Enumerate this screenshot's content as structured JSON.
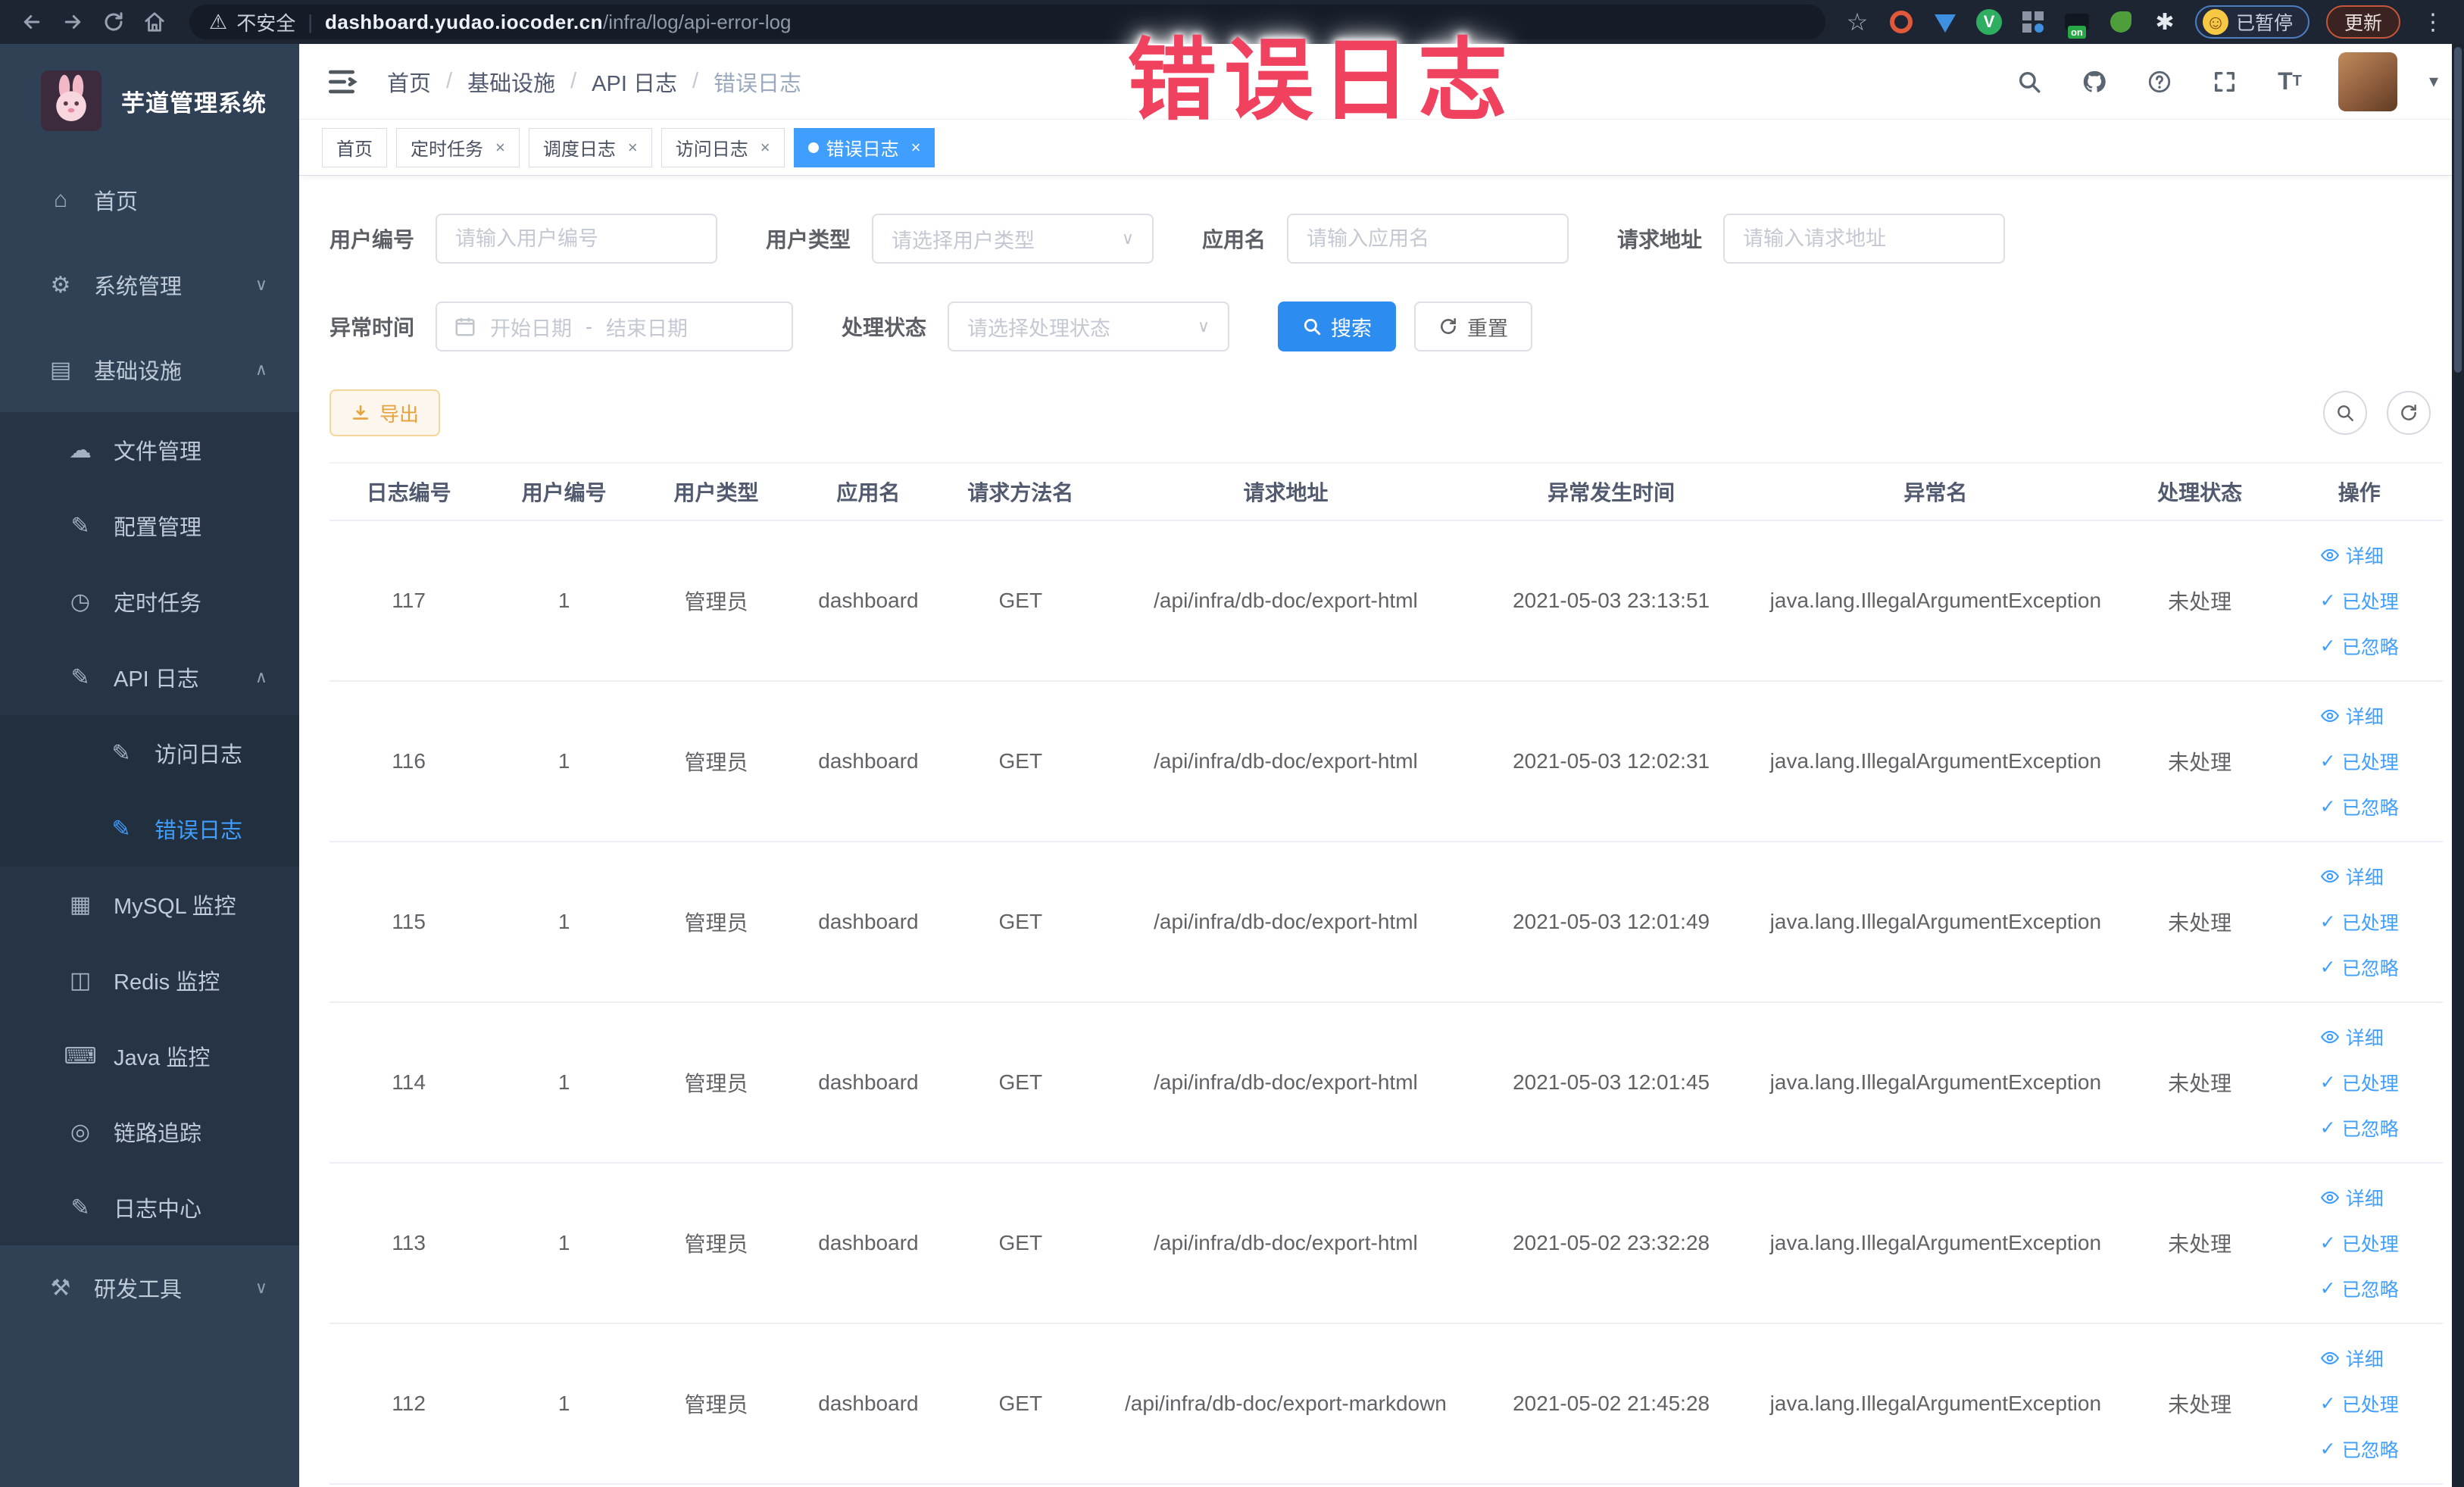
{
  "browser": {
    "security_label": "不安全",
    "url_domain": "dashboard.yudao.iocoder.cn",
    "url_path": "/infra/log/api-error-log",
    "paused_label": "已暂停",
    "update_label": "更新",
    "extension_icons": [
      "star-icon",
      "orange-circle-extension-icon",
      "shield-extension-icon",
      "green-v-extension-icon",
      "grid-extension-icon",
      "onoff-extension-icon",
      "leaf-extension-icon",
      "puzzle-extension-icon"
    ]
  },
  "overlay": {
    "text": "错误日志",
    "color": "#f0415f"
  },
  "sidebar": {
    "title": "芋道管理系统",
    "items": [
      {
        "label": "首页",
        "icon": "home-icon",
        "level": 1
      },
      {
        "label": "系统管理",
        "icon": "gear-icon",
        "level": 1,
        "chevron": "down"
      },
      {
        "label": "基础设施",
        "icon": "infrastructure-icon",
        "level": 1,
        "chevron": "up"
      },
      {
        "label": "文件管理",
        "icon": "file-manage-icon",
        "level": 2
      },
      {
        "label": "配置管理",
        "icon": "config-manage-icon",
        "level": 2
      },
      {
        "label": "定时任务",
        "icon": "scheduled-job-icon",
        "level": 2
      },
      {
        "label": "API 日志",
        "icon": "api-log-icon",
        "level": 2,
        "chevron": "up"
      },
      {
        "label": "访问日志",
        "icon": "access-log-icon",
        "level": 3
      },
      {
        "label": "错误日志",
        "icon": "error-log-icon",
        "level": 3,
        "active": true
      },
      {
        "label": "MySQL 监控",
        "icon": "mysql-monitor-icon",
        "level": 2
      },
      {
        "label": "Redis 监控",
        "icon": "redis-monitor-icon",
        "level": 2
      },
      {
        "label": "Java 监控",
        "icon": "java-monitor-icon",
        "level": 2
      },
      {
        "label": "链路追踪",
        "icon": "trace-icon",
        "level": 2
      },
      {
        "label": "日志中心",
        "icon": "log-center-icon",
        "level": 2
      },
      {
        "label": "研发工具",
        "icon": "devtools-icon",
        "level": 1,
        "chevron": "down"
      }
    ]
  },
  "breadcrumb": [
    "首页",
    "基础设施",
    "API 日志",
    "错误日志"
  ],
  "tabs": [
    {
      "label": "首页",
      "closable": false,
      "active": false
    },
    {
      "label": "定时任务",
      "closable": true,
      "active": false
    },
    {
      "label": "调度日志",
      "closable": true,
      "active": false
    },
    {
      "label": "访问日志",
      "closable": true,
      "active": false
    },
    {
      "label": "错误日志",
      "closable": true,
      "active": true
    }
  ],
  "filters": {
    "user_id": {
      "label": "用户编号",
      "placeholder": "请输入用户编号"
    },
    "user_type": {
      "label": "用户类型",
      "placeholder": "请选择用户类型"
    },
    "app_name": {
      "label": "应用名",
      "placeholder": "请输入应用名"
    },
    "request_url": {
      "label": "请求地址",
      "placeholder": "请输入请求地址"
    },
    "exception_time": {
      "label": "异常时间",
      "start_placeholder": "开始日期",
      "separator": "-",
      "end_placeholder": "结束日期"
    },
    "process_status": {
      "label": "处理状态",
      "placeholder": "请选择处理状态"
    },
    "search_label": "搜索",
    "reset_label": "重置"
  },
  "toolbar": {
    "export_label": "导出"
  },
  "table": {
    "columns": [
      "日志编号",
      "用户编号",
      "用户类型",
      "应用名",
      "请求方法名",
      "请求地址",
      "异常发生时间",
      "异常名",
      "处理状态",
      "操作"
    ],
    "actions": [
      {
        "label": "详细",
        "icon": "eye-icon"
      },
      {
        "label": "已处理",
        "icon": "check-icon"
      },
      {
        "label": "已忽略",
        "icon": "check-icon"
      }
    ],
    "rows": [
      {
        "id": "117",
        "user_id": "1",
        "user_type": "管理员",
        "app_name": "dashboard",
        "method": "GET",
        "request_url": "/api/infra/db-doc/export-html",
        "exception_time": "2021-05-03 23:13:51",
        "exception_name": "java.lang.IllegalArgumentException",
        "status": "未处理"
      },
      {
        "id": "116",
        "user_id": "1",
        "user_type": "管理员",
        "app_name": "dashboard",
        "method": "GET",
        "request_url": "/api/infra/db-doc/export-html",
        "exception_time": "2021-05-03 12:02:31",
        "exception_name": "java.lang.IllegalArgumentException",
        "status": "未处理"
      },
      {
        "id": "115",
        "user_id": "1",
        "user_type": "管理员",
        "app_name": "dashboard",
        "method": "GET",
        "request_url": "/api/infra/db-doc/export-html",
        "exception_time": "2021-05-03 12:01:49",
        "exception_name": "java.lang.IllegalArgumentException",
        "status": "未处理"
      },
      {
        "id": "114",
        "user_id": "1",
        "user_type": "管理员",
        "app_name": "dashboard",
        "method": "GET",
        "request_url": "/api/infra/db-doc/export-html",
        "exception_time": "2021-05-03 12:01:45",
        "exception_name": "java.lang.IllegalArgumentException",
        "status": "未处理"
      },
      {
        "id": "113",
        "user_id": "1",
        "user_type": "管理员",
        "app_name": "dashboard",
        "method": "GET",
        "request_url": "/api/infra/db-doc/export-html",
        "exception_time": "2021-05-02 23:32:28",
        "exception_name": "java.lang.IllegalArgumentException",
        "status": "未处理"
      },
      {
        "id": "112",
        "user_id": "1",
        "user_type": "管理员",
        "app_name": "dashboard",
        "method": "GET",
        "request_url": "/api/infra/db-doc/export-markdown",
        "exception_time": "2021-05-02 21:45:28",
        "exception_name": "java.lang.IllegalArgumentException",
        "status": "未处理"
      }
    ]
  }
}
